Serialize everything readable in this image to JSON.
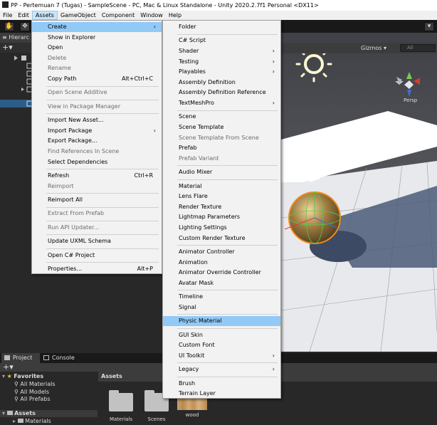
{
  "window": {
    "title": "PP - Pertemuan 7 (Tugas) - SampleScene - PC, Mac & Linux Standalone - Unity 2020.2.7f1 Personal <DX11>"
  },
  "menubar": [
    "File",
    "Edit",
    "Assets",
    "GameObject",
    "Component",
    "Window",
    "Help"
  ],
  "hierarchy": {
    "tab_label": "Hierarc",
    "add_label": "+▾"
  },
  "scene": {
    "gizmos_label": "Gizmos ▾",
    "search_placeholder": "All",
    "persp_label": "Persp"
  },
  "assets_menu": [
    {
      "label": "Create",
      "state": "highlight",
      "submenu": true
    },
    {
      "label": "Show in Explorer"
    },
    {
      "label": "Open"
    },
    {
      "label": "Delete",
      "state": "disabled"
    },
    {
      "label": "Rename",
      "state": "disabled"
    },
    {
      "label": "Copy Path",
      "shortcut": "Alt+Ctrl+C"
    },
    {
      "sep": true
    },
    {
      "label": "Open Scene Additive",
      "state": "disabled"
    },
    {
      "sep": true
    },
    {
      "label": "View in Package Manager",
      "state": "disabled"
    },
    {
      "sep": true
    },
    {
      "label": "Import New Asset..."
    },
    {
      "label": "Import Package",
      "submenu": true
    },
    {
      "label": "Export Package..."
    },
    {
      "label": "Find References In Scene",
      "state": "disabled"
    },
    {
      "label": "Select Dependencies"
    },
    {
      "sep": true
    },
    {
      "label": "Refresh",
      "shortcut": "Ctrl+R"
    },
    {
      "label": "Reimport",
      "state": "disabled"
    },
    {
      "sep": true
    },
    {
      "label": "Reimport All"
    },
    {
      "sep": true
    },
    {
      "label": "Extract From Prefab",
      "state": "disabled"
    },
    {
      "sep": true
    },
    {
      "label": "Run API Updater...",
      "state": "disabled"
    },
    {
      "sep": true
    },
    {
      "label": "Update UXML Schema"
    },
    {
      "sep": true
    },
    {
      "label": "Open C# Project"
    },
    {
      "sep": true
    },
    {
      "label": "Properties...",
      "shortcut": "Alt+P"
    }
  ],
  "create_menu": [
    {
      "label": "Folder"
    },
    {
      "sep": true
    },
    {
      "label": "C# Script"
    },
    {
      "label": "Shader",
      "submenu": true
    },
    {
      "label": "Testing",
      "submenu": true
    },
    {
      "label": "Playables",
      "submenu": true
    },
    {
      "label": "Assembly Definition"
    },
    {
      "label": "Assembly Definition Reference"
    },
    {
      "label": "TextMeshPro",
      "submenu": true
    },
    {
      "sep": true
    },
    {
      "label": "Scene"
    },
    {
      "label": "Scene Template"
    },
    {
      "label": "Scene Template From Scene",
      "state": "disabled"
    },
    {
      "label": "Prefab"
    },
    {
      "label": "Prefab Variant",
      "state": "disabled"
    },
    {
      "sep": true
    },
    {
      "label": "Audio Mixer"
    },
    {
      "sep": true
    },
    {
      "label": "Material"
    },
    {
      "label": "Lens Flare"
    },
    {
      "label": "Render Texture"
    },
    {
      "label": "Lightmap Parameters"
    },
    {
      "label": "Lighting Settings"
    },
    {
      "label": "Custom Render Texture"
    },
    {
      "sep": true
    },
    {
      "label": "Animator Controller"
    },
    {
      "label": "Animation"
    },
    {
      "label": "Animator Override Controller"
    },
    {
      "label": "Avatar Mask"
    },
    {
      "sep": true
    },
    {
      "label": "Timeline"
    },
    {
      "label": "Signal"
    },
    {
      "sep": true
    },
    {
      "label": "Physic Material",
      "state": "highlight"
    },
    {
      "sep": true
    },
    {
      "label": "GUI Skin"
    },
    {
      "label": "Custom Font"
    },
    {
      "label": "UI Toolkit",
      "submenu": true
    },
    {
      "sep": true
    },
    {
      "label": "Legacy",
      "submenu": true
    },
    {
      "sep": true
    },
    {
      "label": "Brush"
    },
    {
      "label": "Terrain Layer"
    }
  ],
  "bottom": {
    "tabs": [
      "Project",
      "Console"
    ],
    "favorites_label": "Favorites",
    "favorites": [
      "All Materials",
      "All Models",
      "All Prefabs"
    ],
    "assets_label": "Assets",
    "asset_tree": [
      "Materials"
    ],
    "assets_header": "Assets",
    "assets": [
      {
        "name": "Materials",
        "kind": "folder"
      },
      {
        "name": "Scenes",
        "kind": "folder"
      },
      {
        "name": "wood",
        "kind": "texture"
      }
    ]
  }
}
